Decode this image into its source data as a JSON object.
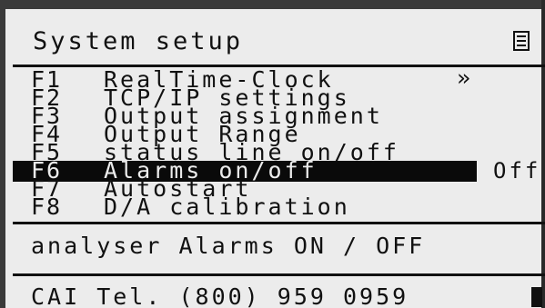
{
  "header": {
    "title": "System setup",
    "menu_icon": "list-menu-icon"
  },
  "menu": {
    "items": [
      {
        "key": "F1",
        "label": "RealTime-Clock",
        "arrow": "»",
        "value": ""
      },
      {
        "key": "F2",
        "label": "TCP/IP settings",
        "arrow": "",
        "value": ""
      },
      {
        "key": "F3",
        "label": "Output assignment",
        "arrow": "",
        "value": ""
      },
      {
        "key": "F4",
        "label": "Output Range",
        "arrow": "",
        "value": ""
      },
      {
        "key": "F5",
        "label": "status line on/off",
        "arrow": "",
        "value": ""
      },
      {
        "key": "F6",
        "label": "Alarms on/off",
        "arrow": "",
        "value": "Off"
      },
      {
        "key": "F7",
        "label": "Autostart",
        "arrow": "",
        "value": ""
      },
      {
        "key": "F8",
        "label": "D/A calibration",
        "arrow": "",
        "value": ""
      }
    ],
    "selected_key": "F6"
  },
  "help": {
    "text": "analyser Alarms ON / OFF"
  },
  "footer": {
    "text": "CAI Tel. (800) 959 0959"
  },
  "colors": {
    "background": "#ececec",
    "foreground": "#111111",
    "highlight": "#0a0a0a"
  }
}
